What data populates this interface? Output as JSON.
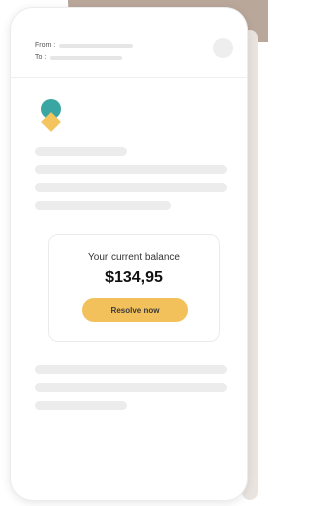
{
  "email": {
    "from_label": "From :",
    "to_label": "To :"
  },
  "balance": {
    "label": "Your current balance",
    "amount": "$134,95",
    "action_label": "Resolve now"
  },
  "colors": {
    "accent": "#f2c15c",
    "logo_teal": "#3aa6a3",
    "logo_yellow": "#f4c45e"
  },
  "icons": {
    "logo": "brand-logo-icon",
    "avatar": "avatar"
  }
}
